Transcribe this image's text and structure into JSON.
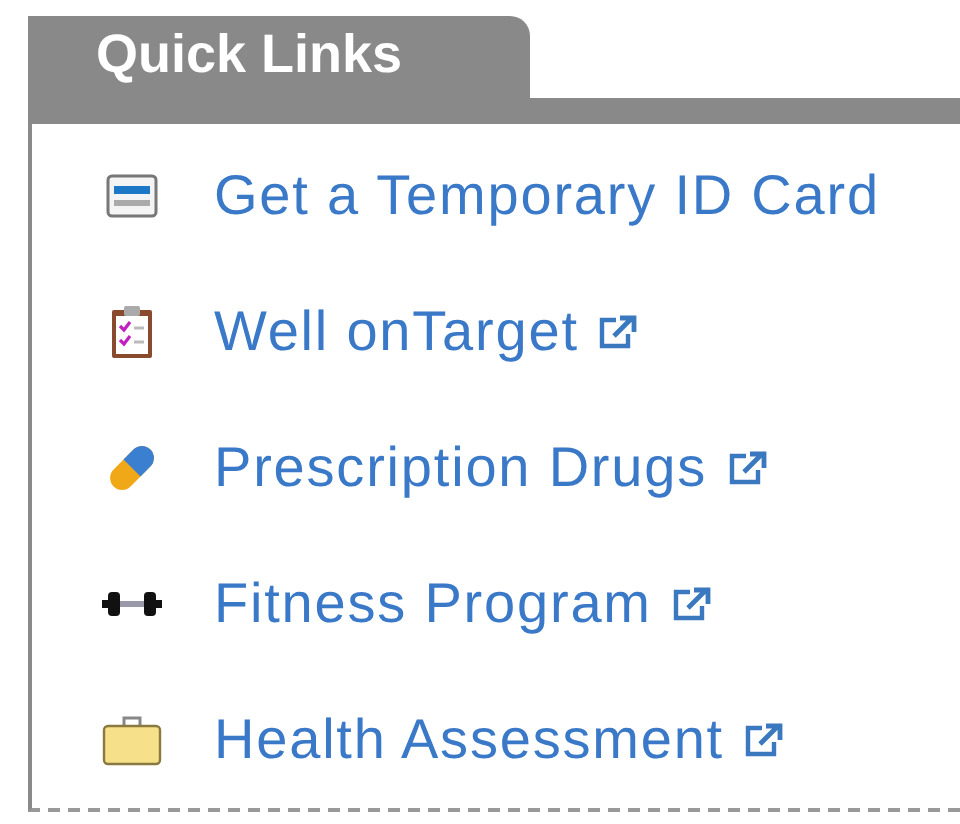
{
  "panel": {
    "title": "Quick Links"
  },
  "links": [
    {
      "kind": "card",
      "label": "Get a Temporary ID Card",
      "external": false
    },
    {
      "kind": "clipboard",
      "label": "Well onTarget",
      "external": true
    },
    {
      "kind": "pill",
      "label": "Prescription Drugs",
      "external": true
    },
    {
      "kind": "dumbbell",
      "label": "Fitness Program",
      "external": true
    },
    {
      "kind": "briefcase",
      "label": "Health Assessment",
      "external": true
    }
  ]
}
